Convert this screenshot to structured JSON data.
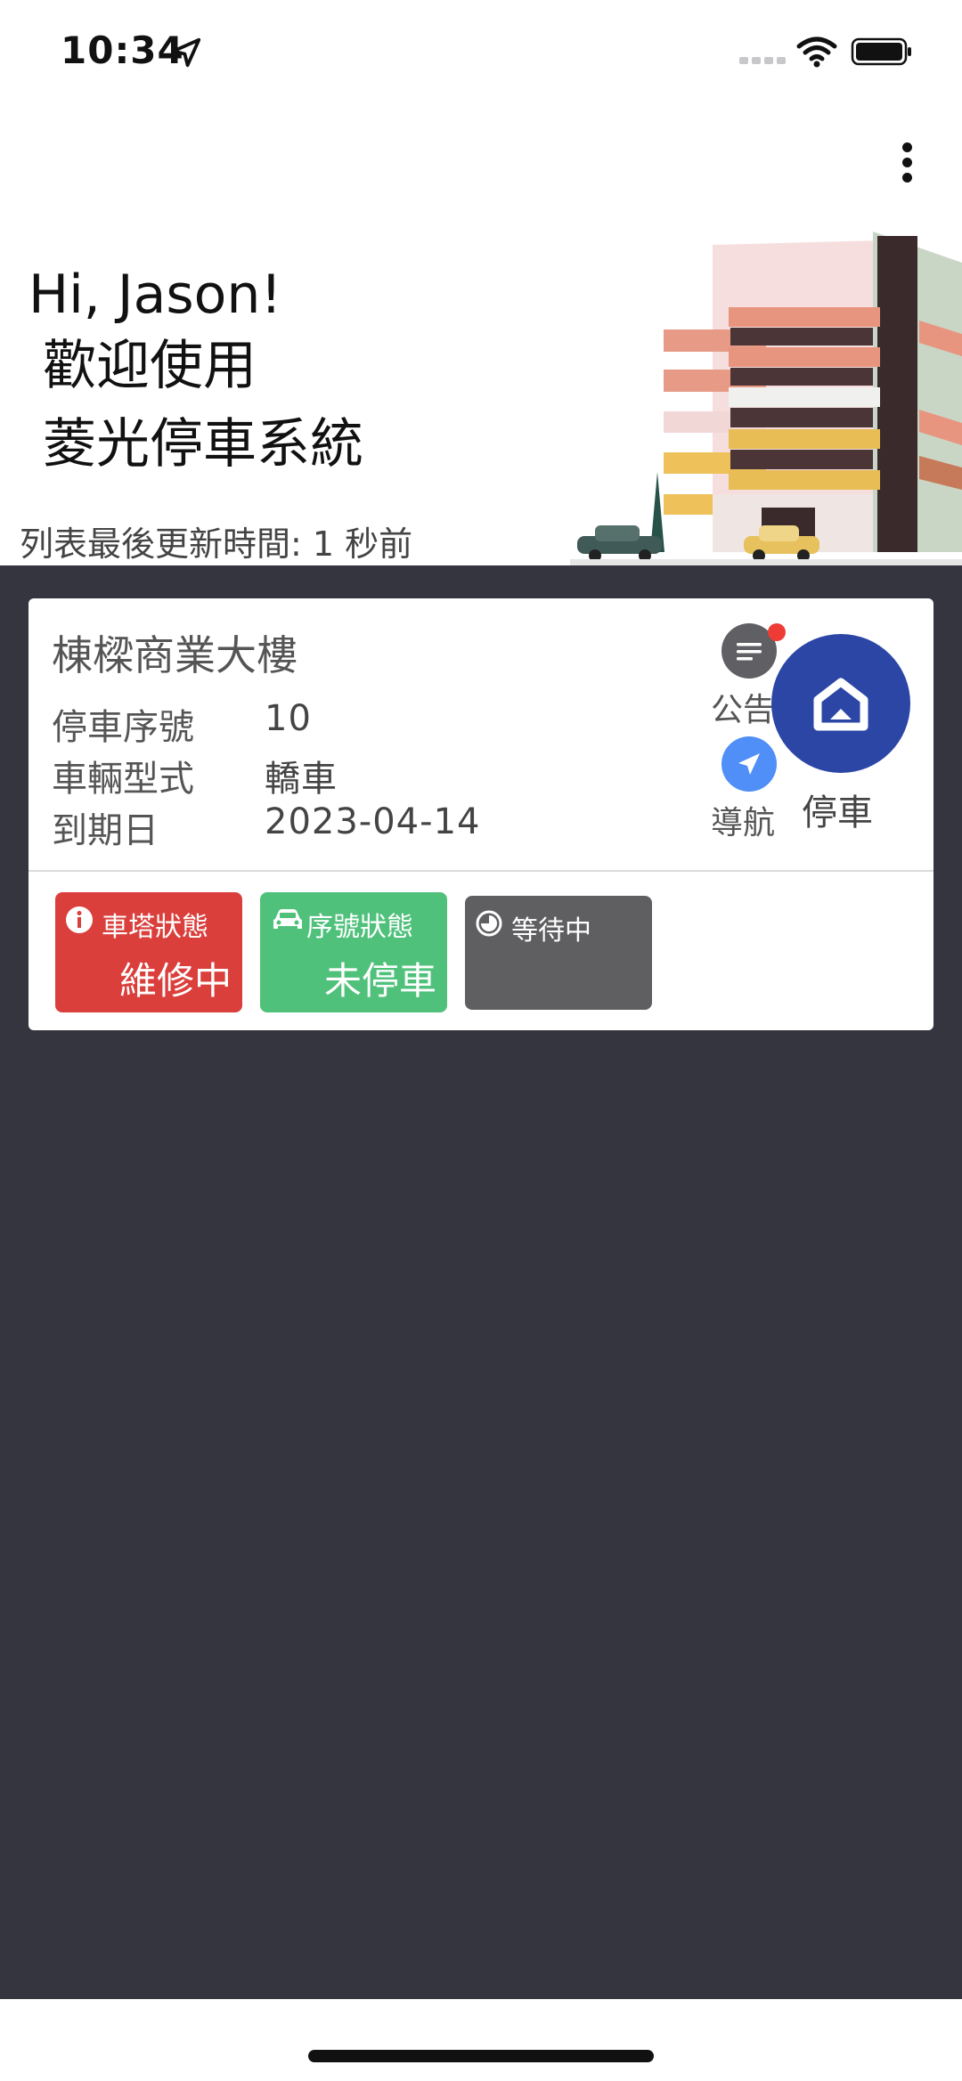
{
  "status_bar": {
    "time": "10:34"
  },
  "header": {
    "greeting": "Hi, Jason!",
    "welcome_line_1": "歡迎使用",
    "welcome_line_2": "菱光停車系統",
    "update_time": "列表最後更新時間: 1 秒前"
  },
  "card": {
    "building_name": "棟樑商業大樓",
    "fields": [
      {
        "label": "停車序號",
        "value": "10"
      },
      {
        "label": "車輛型式",
        "value": "轎車"
      },
      {
        "label": "到期日",
        "value": "2023-04-14"
      }
    ],
    "notice_label": "公告",
    "nav_label": "導航",
    "park_label": "停車",
    "tiles": {
      "tower_status": {
        "title": "車塔狀態",
        "value": "維修中"
      },
      "serial_status": {
        "title": "序號狀態",
        "value": "未停車"
      },
      "waiting": {
        "title": "等待中"
      }
    }
  },
  "colors": {
    "dark_background": "#35353f",
    "tower_tile": "#da3f3c",
    "serial_tile": "#4fc17b",
    "waiting_tile": "#5f5f62",
    "park_button": "#2c46a6",
    "nav_button": "#4f8ff7",
    "notice_badge": "#ef3b35"
  },
  "icons": {
    "status_bar": [
      "location-arrow-icon",
      "signal-icon",
      "wifi-icon",
      "battery-icon"
    ],
    "header": [
      "more-vertical-icon"
    ],
    "card": [
      "notice-list-icon",
      "navigation-arrow-icon",
      "garage-icon",
      "info-icon",
      "car-icon",
      "clock-icon"
    ]
  }
}
